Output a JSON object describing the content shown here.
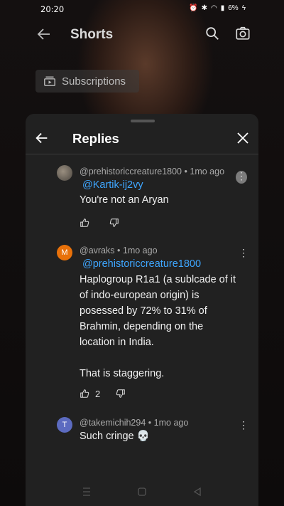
{
  "status_bar": {
    "time": "20:20",
    "battery": "6%"
  },
  "shorts_header": {
    "title": "Shorts"
  },
  "subscriptions_chip": {
    "label": "Subscriptions"
  },
  "replies_sheet": {
    "title": "Replies",
    "comments": [
      {
        "author": "@prehistoriccreature1800",
        "age": "1mo ago",
        "mention": "@Kartik-ij2vy",
        "text": "You're not an Aryan",
        "likes": ""
      },
      {
        "avatar_letter": "M",
        "avatar_color": "#e8710a",
        "author": "@avraks",
        "age": "1mo ago",
        "mention": "@prehistoriccreature1800",
        "text_lines": [
          "Haplogroup R1a1 (a sublcade of it",
          "of indo-european origin) is",
          "posessed by 72% to 31% of",
          "Brahmin, depending on the",
          "location in India.",
          "",
          "That is staggering."
        ],
        "likes": "2"
      },
      {
        "avatar_letter": "T",
        "avatar_color": "#5c6bc0",
        "author": "@takemichih294",
        "age": "1mo ago",
        "text": "Such cringe 💀"
      }
    ]
  },
  "separator": "•"
}
